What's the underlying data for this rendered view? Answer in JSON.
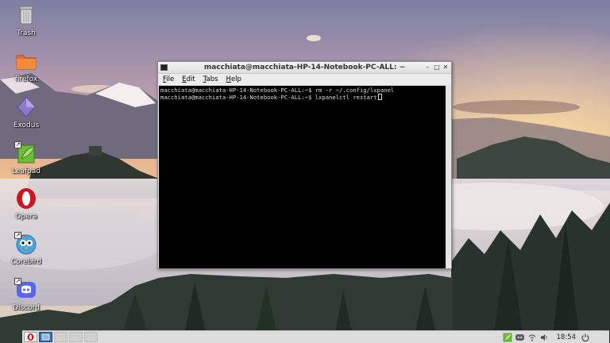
{
  "desktop": {
    "icons": [
      {
        "label": "Trash",
        "icon": "trash-icon"
      },
      {
        "label": "firefox",
        "icon": "folder-icon"
      },
      {
        "label": "Exodus",
        "icon": "exodus-icon"
      },
      {
        "label": "Leafpad",
        "icon": "leafpad-icon"
      },
      {
        "label": "Opera",
        "icon": "opera-icon"
      },
      {
        "label": "Corebird",
        "icon": "corebird-icon"
      },
      {
        "label": "Discord",
        "icon": "discord-icon"
      }
    ]
  },
  "terminal": {
    "title": "macchiata@macchiata-HP-14-Notebook-PC-ALL: ~",
    "menu": [
      {
        "label": "File",
        "underline": "F",
        "rest": "ile"
      },
      {
        "label": "Edit",
        "underline": "E",
        "rest": "dit"
      },
      {
        "label": "Tabs",
        "underline": "T",
        "rest": "abs"
      },
      {
        "label": "Help",
        "underline": "H",
        "rest": "elp"
      }
    ],
    "buttons": {
      "minimize": "–",
      "maximize": "□",
      "close": "✕"
    },
    "lines": [
      "macchiata@macchiata-HP-14-Notebook-PC-ALL:~$ rm -r ~/.config/lxpanel",
      "macchiata@macchiata-HP-14-Notebook-PC-ALL:~$ lxpanelctl restart"
    ]
  },
  "taskbar": {
    "clock": "18:54",
    "launchers": [
      {
        "name": "opera-icon"
      },
      {
        "name": "desktop-icon"
      }
    ],
    "tray": [
      "leafpad-icon",
      "discord-icon",
      "network-icon",
      "volume-icon"
    ],
    "power": "power-icon"
  },
  "colors": {
    "terminal_bg": "#000000",
    "terminal_fg": "#d8d8d8",
    "opera_red": "#cc1622",
    "discord_blurple": "#5865f2",
    "taskbar_bg": "#dcdcdc"
  }
}
